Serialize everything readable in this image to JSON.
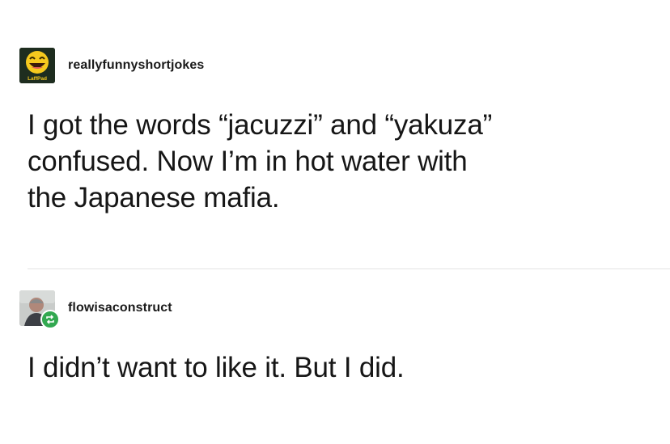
{
  "posts": [
    {
      "username": "reallyfunnyshortjokes",
      "lines": [
        "I got the words “jacuzzi” and “yakuza”",
        "confused. Now I’m in hot water with",
        "the Japanese mafia."
      ],
      "avatar_icon": "laughing-emoji-icon",
      "avatar_logo_text": "LaffPad"
    },
    {
      "username": "flowisaconstruct",
      "lines": [
        "I didn’t want to like it. But I did."
      ],
      "avatar_icon": "user-photo-icon",
      "badge_icon": "reblog-icon"
    }
  ],
  "colors": {
    "badge": "#32a850",
    "emoji": "#f6c91e",
    "divider": "#e3e3e3"
  }
}
